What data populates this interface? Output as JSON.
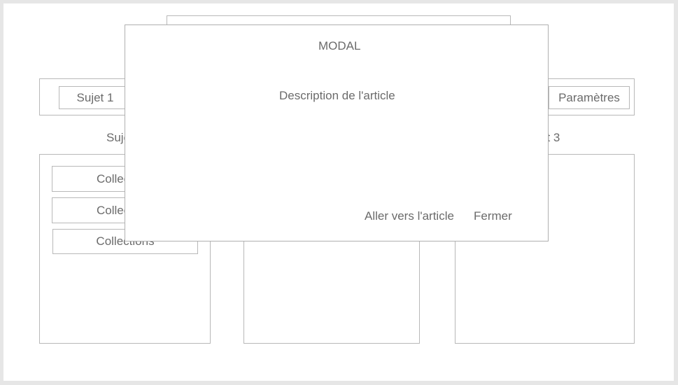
{
  "nav": {
    "topic_1": "Sujet 1",
    "settings": "Paramètres"
  },
  "columns": {
    "col1_title": "Suje",
    "col3_title": "et 3",
    "collections": [
      "Collec",
      "Collec",
      "Collections"
    ]
  },
  "modal": {
    "title": "MODAL",
    "description": "Description de l'article",
    "go_to_article": "Aller vers l'article",
    "close": "Fermer"
  }
}
